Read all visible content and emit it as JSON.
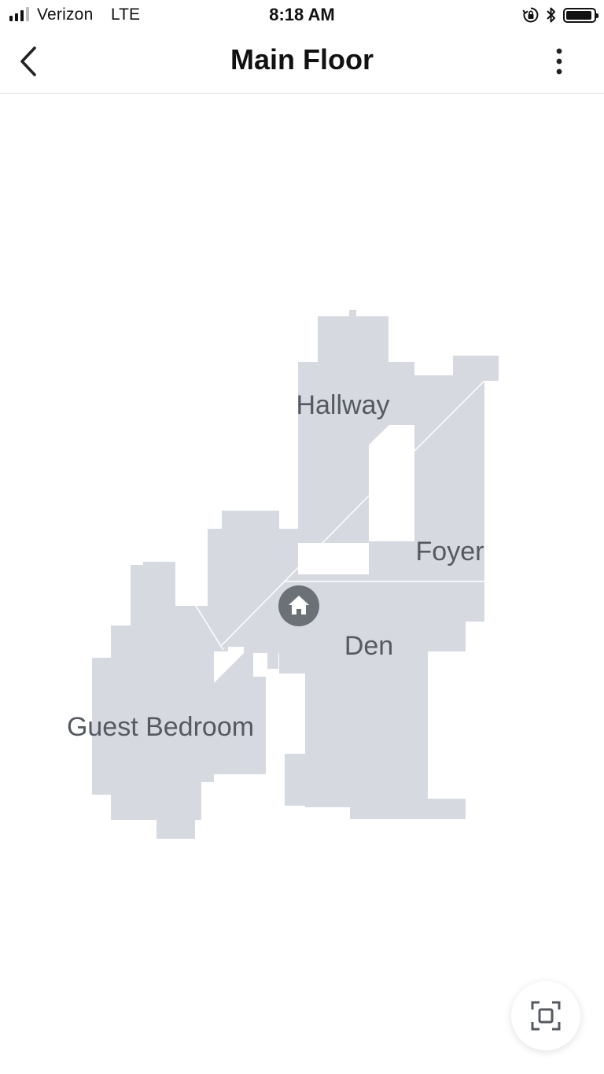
{
  "status_bar": {
    "carrier": "Verizon",
    "network": "LTE",
    "time": "8:18 AM",
    "signal_bars": 4,
    "signal_bars_active": 3,
    "battery_level": 0.95,
    "icons": [
      "orientation-lock-icon",
      "bluetooth-icon",
      "battery-icon"
    ]
  },
  "nav": {
    "title": "Main Floor",
    "back_icon": "chevron-left-icon",
    "more_icon": "more-vertical-icon"
  },
  "map": {
    "rooms": [
      {
        "name": "Hallway"
      },
      {
        "name": "Foyer"
      },
      {
        "name": "Den"
      },
      {
        "name": "Guest Bedroom"
      }
    ],
    "dock_icon": "home-icon",
    "fit_icon": "fit-screen-icon"
  },
  "colors": {
    "floor": "#d6d9e0",
    "label": "#555a60",
    "dock": "#6b7177",
    "divider": "#ffffff"
  }
}
